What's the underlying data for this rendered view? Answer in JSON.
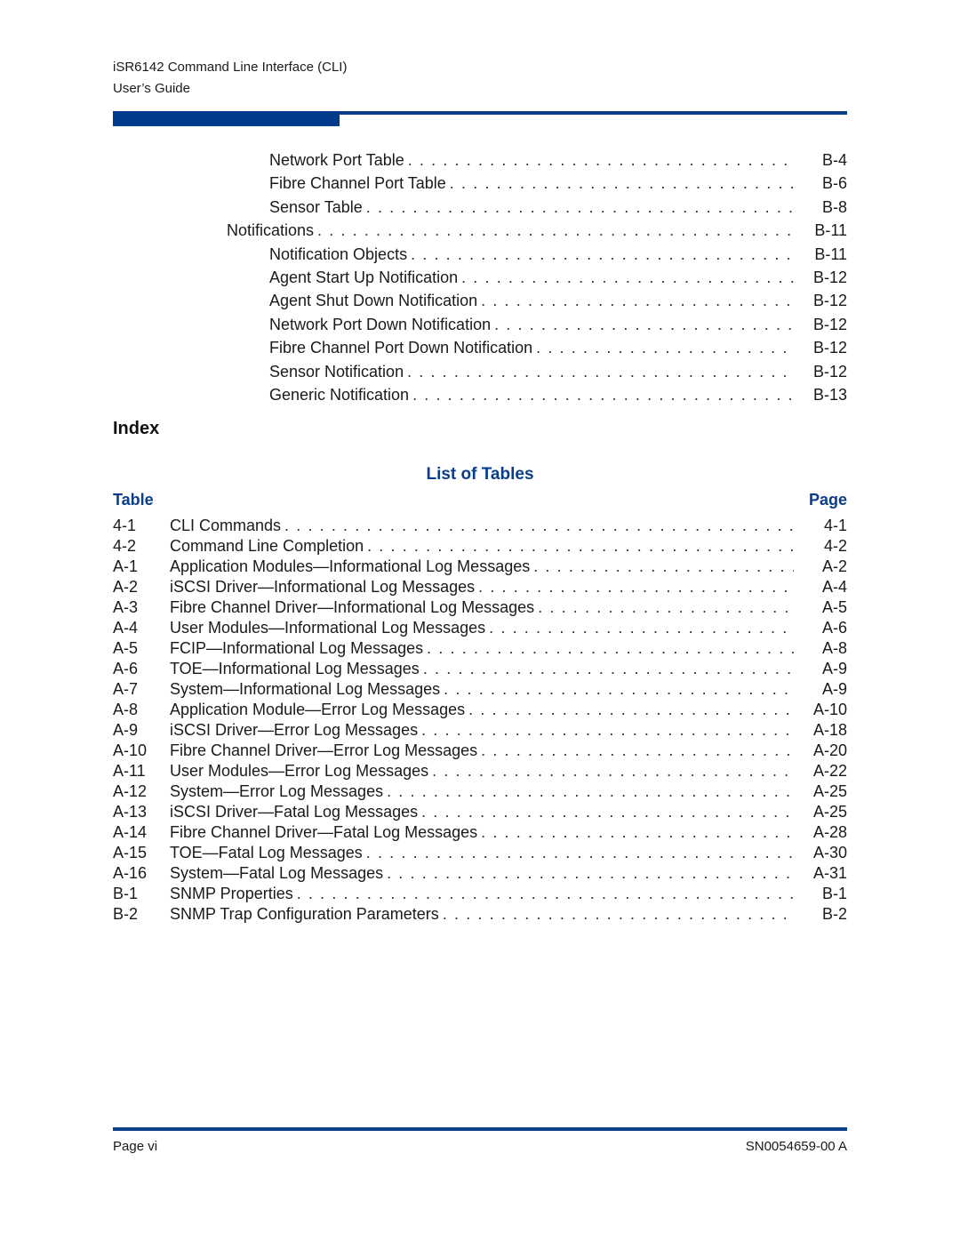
{
  "header": {
    "line1": "iSR6142 Command Line Interface (CLI)",
    "line2": "User’s Guide"
  },
  "toc": [
    {
      "title": "Network Port Table",
      "page": "B-4",
      "level": 2
    },
    {
      "title": "Fibre Channel Port Table",
      "page": "B-6",
      "level": 2
    },
    {
      "title": "Sensor Table",
      "page": "B-8",
      "level": 2
    },
    {
      "title": "Notifications",
      "page": "B-11",
      "level": 1
    },
    {
      "title": "Notification Objects",
      "page": "B-11",
      "level": 2
    },
    {
      "title": "Agent Start Up Notification",
      "page": "B-12",
      "level": 2
    },
    {
      "title": "Agent Shut Down Notification",
      "page": "B-12",
      "level": 2
    },
    {
      "title": "Network Port Down Notification",
      "page": "B-12",
      "level": 2
    },
    {
      "title": "Fibre Channel Port Down Notification",
      "page": "B-12",
      "level": 2
    },
    {
      "title": "Sensor Notification",
      "page": "B-12",
      "level": 2
    },
    {
      "title": "Generic Notification",
      "page": "B-13",
      "level": 2
    }
  ],
  "index_heading": "Index",
  "list_of_tables": {
    "title": "List of Tables",
    "col_table": "Table",
    "col_page": "Page",
    "rows": [
      {
        "num": "4-1",
        "title": "CLI Commands",
        "page": "4-1"
      },
      {
        "num": "4-2",
        "title": "Command Line Completion",
        "page": "4-2"
      },
      {
        "num": "A-1",
        "title": "Application Modules—Informational Log Messages",
        "page": "A-2"
      },
      {
        "num": "A-2",
        "title": "iSCSI Driver—Informational Log Messages",
        "page": "A-4"
      },
      {
        "num": "A-3",
        "title": "Fibre Channel Driver—Informational Log Messages",
        "page": "A-5"
      },
      {
        "num": "A-4",
        "title": "User Modules—Informational Log Messages",
        "page": "A-6"
      },
      {
        "num": "A-5",
        "title": "FCIP—Informational Log Messages",
        "page": "A-8"
      },
      {
        "num": "A-6",
        "title": "TOE—Informational Log Messages",
        "page": "A-9"
      },
      {
        "num": "A-7",
        "title": "System—Informational Log Messages",
        "page": "A-9"
      },
      {
        "num": "A-8",
        "title": "Application Module—Error Log Messages",
        "page": "A-10"
      },
      {
        "num": "A-9",
        "title": "iSCSI Driver—Error Log Messages",
        "page": "A-18"
      },
      {
        "num": "A-10",
        "title": "Fibre Channel Driver—Error Log Messages",
        "page": "A-20"
      },
      {
        "num": "A-11",
        "title": "User Modules—Error Log Messages",
        "page": "A-22"
      },
      {
        "num": "A-12",
        "title": "System—Error Log Messages",
        "page": "A-25"
      },
      {
        "num": "A-13",
        "title": "iSCSI Driver—Fatal Log Messages",
        "page": "A-25"
      },
      {
        "num": "A-14",
        "title": "Fibre Channel Driver—Fatal Log Messages",
        "page": "A-28"
      },
      {
        "num": "A-15",
        "title": "TOE—Fatal Log Messages",
        "page": "A-30"
      },
      {
        "num": "A-16",
        "title": "System—Fatal Log Messages",
        "page": "A-31"
      },
      {
        "num": "B-1",
        "title": "SNMP Properties",
        "page": "B-1"
      },
      {
        "num": "B-2",
        "title": "SNMP Trap Configuration Parameters",
        "page": "B-2"
      }
    ]
  },
  "footer": {
    "left": "Page vi",
    "right": "SN0054659-00 A"
  },
  "colors": {
    "accent": "#0a3d8a"
  }
}
